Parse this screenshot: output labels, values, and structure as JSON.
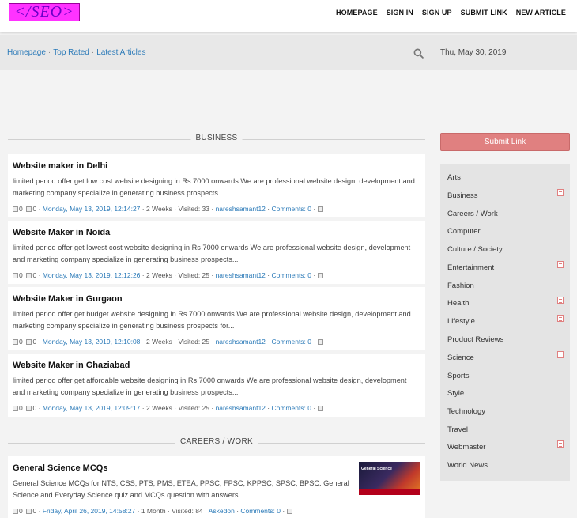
{
  "header": {
    "logo_text": "</SEO>",
    "nav": [
      "HOMEPAGE",
      "SIGN IN",
      "SIGN UP",
      "SUBMIT LINK",
      "NEW ARTICLE"
    ]
  },
  "subbar": {
    "breadcrumbs": [
      "Homepage",
      "Top Rated",
      "Latest Articles"
    ],
    "date": "Thu, May 30, 2019"
  },
  "sections": [
    {
      "title": "BUSINESS"
    },
    {
      "title": "CAREERS / WORK"
    }
  ],
  "articles": [
    {
      "title": "Website maker in Delhi",
      "excerpt": "limited period offer get low cost website designing in Rs 7000 onwards We are professional website design, development and marketing company specialize in generating business prospects...",
      "up": "0",
      "down": "0",
      "date": "Monday, May 13, 2019, 12:14:27",
      "age": "2 Weeks",
      "visited": "Visited: 33",
      "author": "nareshsamant12",
      "comments": "Comments: 0"
    },
    {
      "title": "Website Maker in Noida",
      "excerpt": "limited period offer get lowest cost website designing in Rs 7000 onwards We are professional website design, development and marketing company specialize in generating business prospects...",
      "up": "0",
      "down": "0",
      "date": "Monday, May 13, 2019, 12:12:26",
      "age": "2 Weeks",
      "visited": "Visited: 25",
      "author": "nareshsamant12",
      "comments": "Comments: 0"
    },
    {
      "title": "Website Maker in Gurgaon",
      "excerpt": "limited period offer get budget website designing in Rs 7000 onwards We are professional website design, development and marketing company specialize in generating business prospects for...",
      "up": "0",
      "down": "0",
      "date": "Monday, May 13, 2019, 12:10:08",
      "age": "2 Weeks",
      "visited": "Visited: 25",
      "author": "nareshsamant12",
      "comments": "Comments: 0"
    },
    {
      "title": "Website Maker in Ghaziabad",
      "excerpt": "limited period offer get affordable website designing in Rs 7000 onwards We are professional website design, development and marketing company specialize in generating business prospects...",
      "up": "0",
      "down": "0",
      "date": "Monday, May 13, 2019, 12:09:17",
      "age": "2 Weeks",
      "visited": "Visited: 25",
      "author": "nareshsamant12",
      "comments": "Comments: 0"
    },
    {
      "title": "General Science MCQs",
      "excerpt": "General Science MCQs for NTS, CSS, PTS, PMS, ETEA, PPSC, FPSC, KPPSC, SPSC, BPSC. General Science and Everyday Science quiz and MCQs question with answers.",
      "up": "0",
      "down": "0",
      "date": "Friday, April 26, 2019, 14:58:27",
      "age": "1 Month",
      "visited": "Visited: 84",
      "author": "Askedon",
      "comments": "Comments: 0",
      "thumb_caption": "General Science"
    }
  ],
  "sidebar": {
    "submit_label": "Submit Link",
    "categories": [
      {
        "name": "Arts",
        "rss": false
      },
      {
        "name": "Business",
        "rss": true
      },
      {
        "name": "Careers / Work",
        "rss": false
      },
      {
        "name": "Computer",
        "rss": false
      },
      {
        "name": "Culture / Society",
        "rss": false
      },
      {
        "name": "Entertainment",
        "rss": true
      },
      {
        "name": "Fashion",
        "rss": false
      },
      {
        "name": "Health",
        "rss": true
      },
      {
        "name": "Lifestyle",
        "rss": true
      },
      {
        "name": "Product Reviews",
        "rss": false
      },
      {
        "name": "Science",
        "rss": true
      },
      {
        "name": "Sports",
        "rss": false
      },
      {
        "name": "Style",
        "rss": false
      },
      {
        "name": "Technology",
        "rss": false
      },
      {
        "name": "Travel",
        "rss": false
      },
      {
        "name": "Webmaster",
        "rss": true
      },
      {
        "name": "World News",
        "rss": false
      }
    ]
  },
  "colors": {
    "accent_link": "#2b7ab8",
    "submit_button": "#e08080",
    "logo_bg": "#ff33ff"
  }
}
